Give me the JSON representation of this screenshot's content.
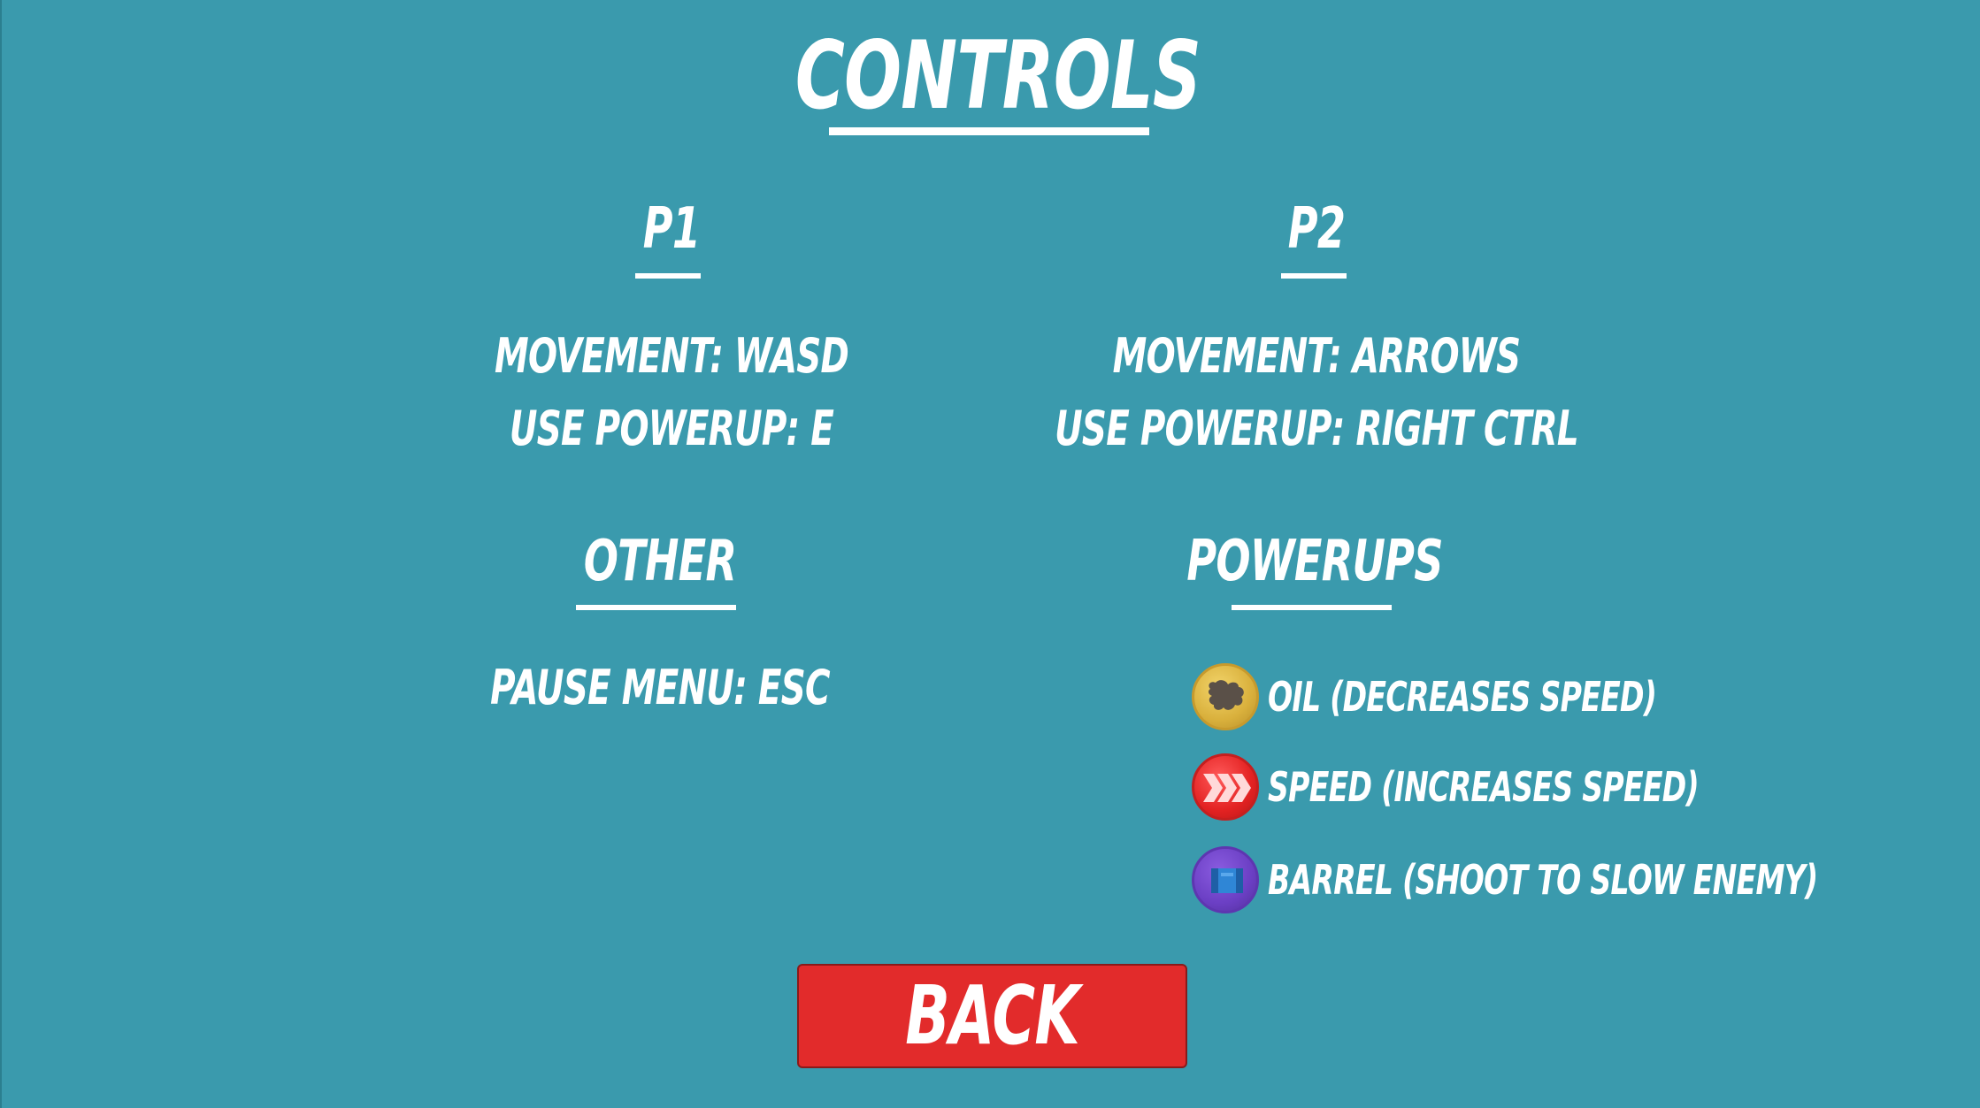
{
  "title": "CONTROLS",
  "players": [
    {
      "header": "P1",
      "movement": "MOVEMENT: WASD",
      "use_powerup": "USE POWERUP: E"
    },
    {
      "header": "P2",
      "movement": "MOVEMENT: ARROWS",
      "use_powerup": "USE POWERUP: RIGHT CTRL"
    }
  ],
  "other": {
    "header": "OTHER",
    "pause": "PAUSE MENU: ESC"
  },
  "powerups": {
    "header": "POWERUPS",
    "items": [
      {
        "icon": "oil-icon",
        "label": "OIL (DECREASES SPEED)",
        "color": "#d9b03c"
      },
      {
        "icon": "speed-icon",
        "label": "SPEED (INCREASES SPEED)",
        "color": "#e32222"
      },
      {
        "icon": "barrel-icon",
        "label": "BARREL (SHOOT TO SLOW ENEMY)",
        "color": "#6b3fc4"
      }
    ]
  },
  "back_button": {
    "label": "BACK",
    "color": "#e22b2b"
  },
  "colors": {
    "background": "#3a9aad",
    "text": "#ffffff"
  }
}
